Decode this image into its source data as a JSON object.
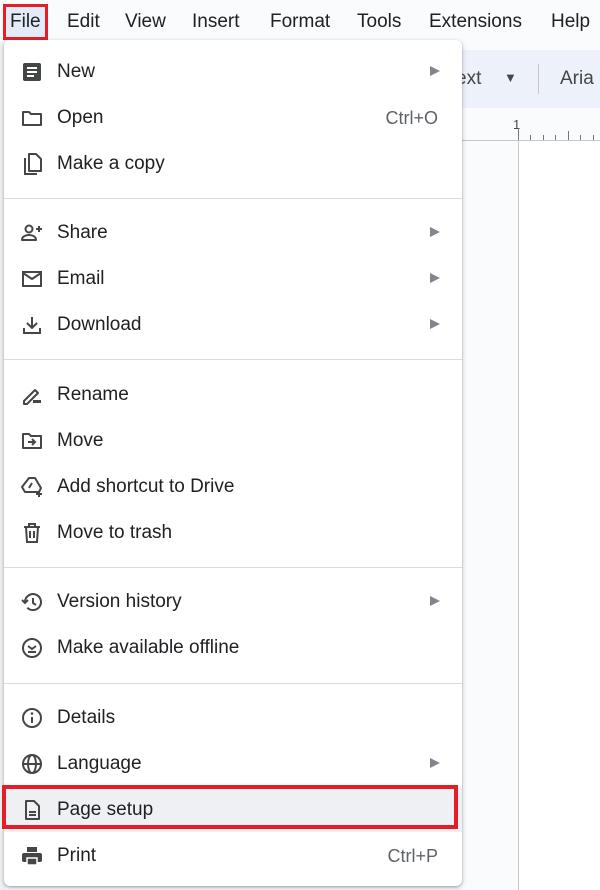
{
  "menubar": {
    "items": [
      "File",
      "Edit",
      "View",
      "Insert",
      "Format",
      "Tools",
      "Extensions",
      "Help"
    ],
    "active": "File"
  },
  "toolbar": {
    "style_select_partial": "ext",
    "font_select_partial": "Aria"
  },
  "ruler": {
    "label": "1"
  },
  "file_menu": {
    "items": [
      {
        "label": "New",
        "icon": "docs-icon",
        "submenu": true
      },
      {
        "label": "Open",
        "icon": "folder-icon",
        "shortcut": "Ctrl+O"
      },
      {
        "label": "Make a copy",
        "icon": "copy-icon"
      },
      {
        "label": "Share",
        "icon": "person-add-icon",
        "submenu": true
      },
      {
        "label": "Email",
        "icon": "email-icon",
        "submenu": true
      },
      {
        "label": "Download",
        "icon": "download-icon",
        "submenu": true
      },
      {
        "label": "Rename",
        "icon": "rename-pencil-icon"
      },
      {
        "label": "Move",
        "icon": "move-folder-icon"
      },
      {
        "label": "Add shortcut to Drive",
        "icon": "drive-shortcut-icon"
      },
      {
        "label": "Move to trash",
        "icon": "trash-icon"
      },
      {
        "label": "Version history",
        "icon": "history-icon",
        "submenu": true
      },
      {
        "label": "Make available offline",
        "icon": "offline-icon"
      },
      {
        "label": "Details",
        "icon": "info-icon"
      },
      {
        "label": "Language",
        "icon": "globe-icon",
        "submenu": true
      },
      {
        "label": "Page setup",
        "icon": "page-icon",
        "highlighted": true
      },
      {
        "label": "Print",
        "icon": "print-icon",
        "shortcut": "Ctrl+P"
      }
    ]
  },
  "colors": {
    "highlight_border": "#e41e26",
    "menubar_active_bg": "#e3ebf8",
    "toolbar_bg": "#edf2fa"
  }
}
